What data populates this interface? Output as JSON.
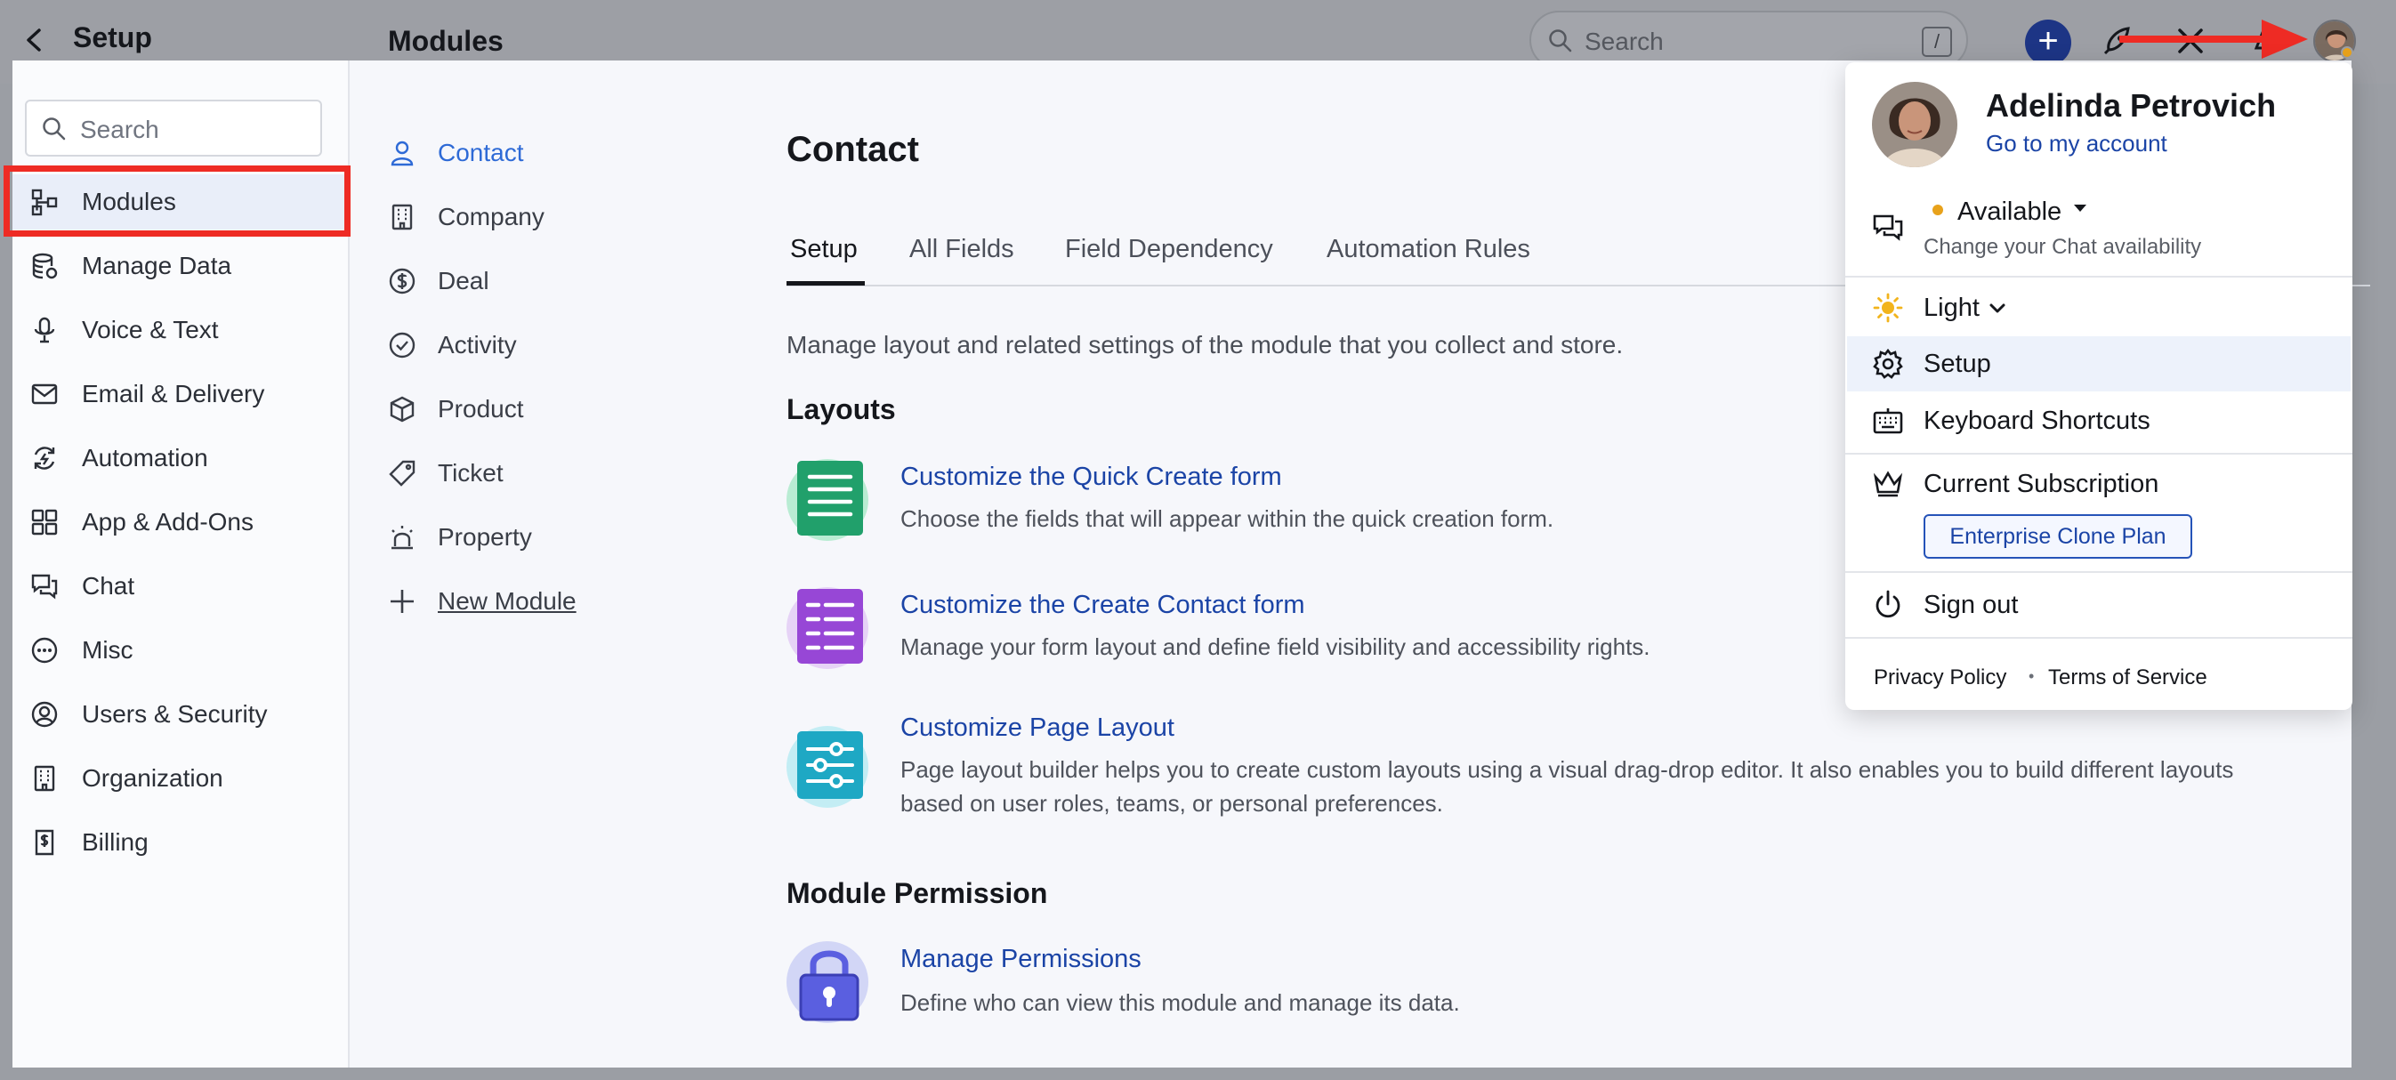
{
  "header": {
    "setup_title": "Setup",
    "modules_title": "Modules",
    "search_placeholder": "Search",
    "search_shortcut": "/",
    "plus_label": "+"
  },
  "sidebar": {
    "search_placeholder": "Search",
    "items": [
      {
        "label": "Modules",
        "icon": "modules-icon",
        "active": true
      },
      {
        "label": "Manage Data",
        "icon": "database-icon"
      },
      {
        "label": "Voice & Text",
        "icon": "microphone-icon"
      },
      {
        "label": "Email & Delivery",
        "icon": "mail-icon"
      },
      {
        "label": "Automation",
        "icon": "automation-icon"
      },
      {
        "label": "App & Add-Ons",
        "icon": "apps-grid-icon"
      },
      {
        "label": "Chat",
        "icon": "chat-icon"
      },
      {
        "label": "Misc",
        "icon": "more-dots-icon"
      },
      {
        "label": "Users & Security",
        "icon": "user-circle-icon"
      },
      {
        "label": "Organization",
        "icon": "building-icon"
      },
      {
        "label": "Billing",
        "icon": "billing-icon"
      }
    ]
  },
  "modules": {
    "items": [
      {
        "label": "Contact",
        "icon": "person-icon",
        "active": true
      },
      {
        "label": "Company",
        "icon": "building-icon"
      },
      {
        "label": "Deal",
        "icon": "dollar-icon"
      },
      {
        "label": "Activity",
        "icon": "check-circle-icon"
      },
      {
        "label": "Product",
        "icon": "box-icon"
      },
      {
        "label": "Ticket",
        "icon": "tag-icon"
      },
      {
        "label": "Property",
        "icon": "alarm-icon"
      },
      {
        "label": "New Module",
        "icon": "plus-icon"
      }
    ]
  },
  "content": {
    "title": "Contact",
    "tabs": [
      "Setup",
      "All Fields",
      "Field Dependency",
      "Automation Rules"
    ],
    "description": "Manage layout and related settings of the module that you collect and store.",
    "layouts_heading": "Layouts",
    "cards": [
      {
        "title": "Customize the Quick Create form",
        "desc": "Choose the fields that will appear within the quick creation form."
      },
      {
        "title": "Customize the Create Contact form",
        "desc": "Manage your form layout and define field visibility and accessibility rights."
      },
      {
        "title": "Customize Page Layout",
        "desc1": "Page layout builder helps you to create custom layouts using a visual drag-drop editor. It also enables you to build different layouts",
        "desc2": "based on user roles, teams, or personal preferences."
      }
    ],
    "permission_heading": "Module Permission",
    "permission": {
      "title": "Manage Permissions",
      "desc": "Define who can view this module and manage its data."
    }
  },
  "dropdown": {
    "name": "Adelinda Petrovich",
    "account_link": "Go to my account",
    "status": "Available",
    "status_hint": "Change your Chat availability",
    "theme": "Light",
    "setup": "Setup",
    "shortcuts": "Keyboard Shortcuts",
    "subscription": "Current Subscription",
    "plan": "Enterprise Clone Plan",
    "signout": "Sign out",
    "privacy": "Privacy Policy",
    "bullet": "•",
    "terms": "Terms of Service"
  },
  "colors": {
    "accent": "#2e6ad6",
    "link": "#1b44a6",
    "highlight": "#ee2b24",
    "status_available": "#e8a21b"
  }
}
